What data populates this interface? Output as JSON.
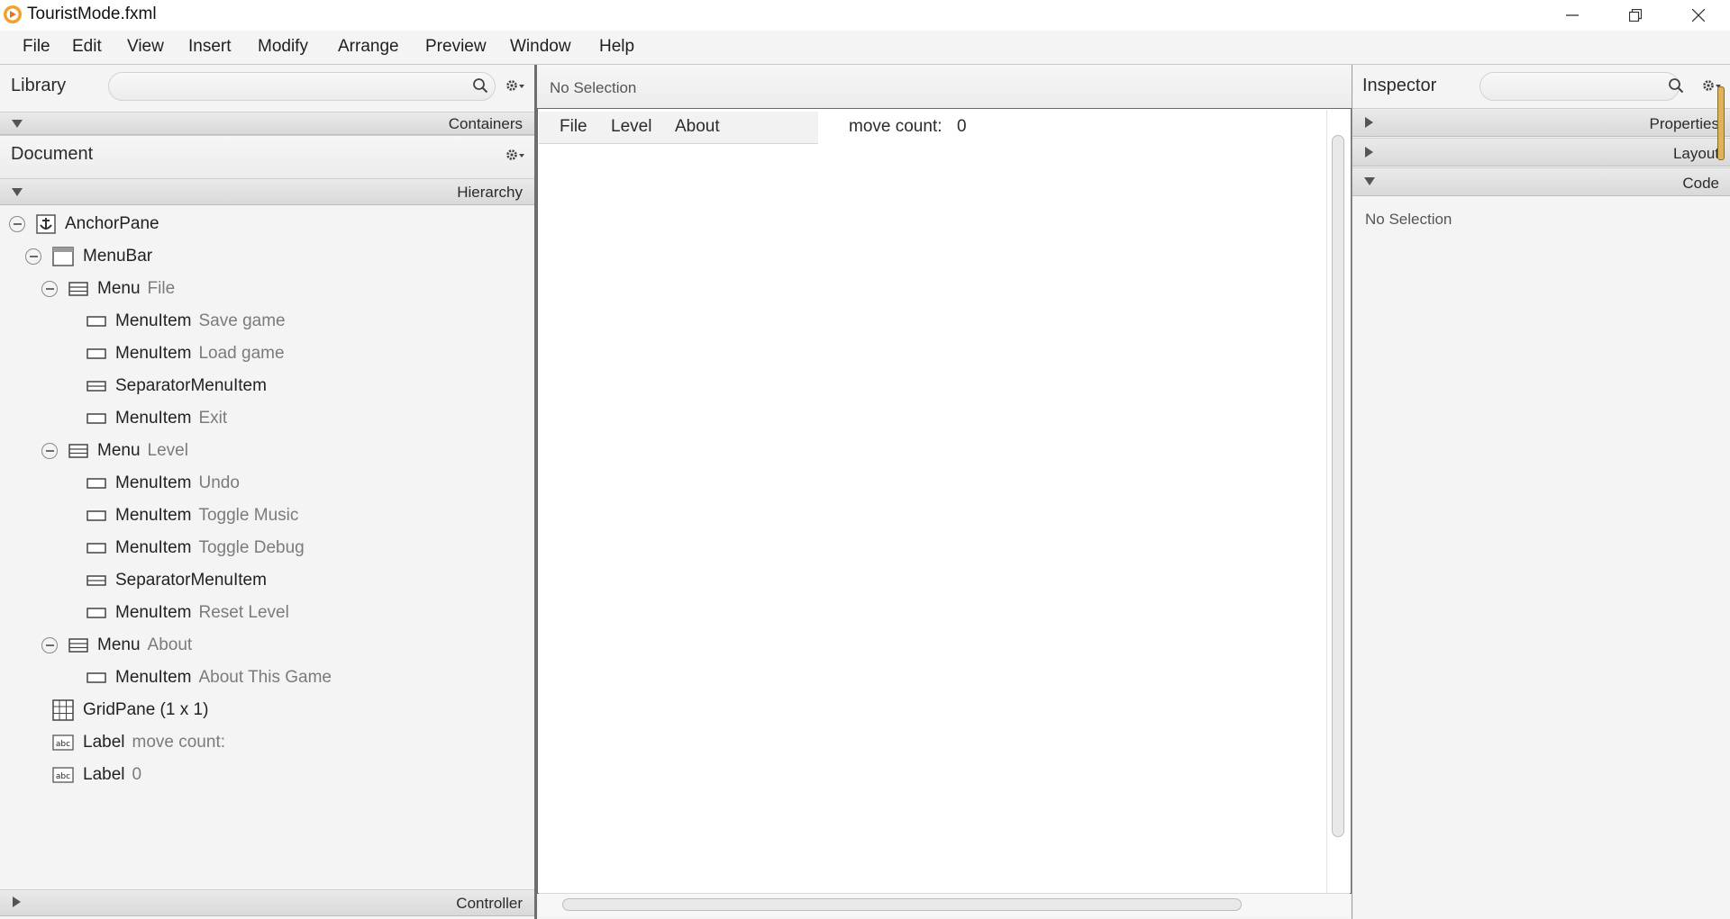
{
  "window": {
    "title": "TouristMode.fxml",
    "minimize_icon": "minimize-icon",
    "restore_icon": "restore-icon",
    "close_icon": "close-icon"
  },
  "menu_bar": [
    "File",
    "Edit",
    "View",
    "Insert",
    "Modify",
    "Arrange",
    "Preview",
    "Window",
    "Help"
  ],
  "library": {
    "title": "Library",
    "search_placeholder": "",
    "sections": [
      {
        "label": "Containers",
        "expanded": false
      }
    ]
  },
  "document": {
    "title": "Document",
    "hierarchy_label": "Hierarchy",
    "controller_label": "Controller",
    "tree": [
      {
        "type": "AnchorPane",
        "text": "",
        "icon": "anchor-icon",
        "depth": 0,
        "toggle": true
      },
      {
        "type": "MenuBar",
        "text": "",
        "icon": "menubar-icon",
        "depth": 1,
        "toggle": true
      },
      {
        "type": "Menu",
        "text": "File",
        "icon": "menu-icon",
        "depth": 2,
        "toggle": true
      },
      {
        "type": "MenuItem",
        "text": "Save game",
        "icon": "menuitem-icon",
        "depth": 3,
        "toggle": false
      },
      {
        "type": "MenuItem",
        "text": "Load game",
        "icon": "menuitem-icon",
        "depth": 3,
        "toggle": false
      },
      {
        "type": "SeparatorMenuItem",
        "text": "",
        "icon": "separator-menuitem-icon",
        "depth": 3,
        "toggle": false
      },
      {
        "type": "MenuItem",
        "text": "Exit",
        "icon": "menuitem-icon",
        "depth": 3,
        "toggle": false
      },
      {
        "type": "Menu",
        "text": "Level",
        "icon": "menu-icon",
        "depth": 2,
        "toggle": true
      },
      {
        "type": "MenuItem",
        "text": "Undo",
        "icon": "menuitem-icon",
        "depth": 3,
        "toggle": false
      },
      {
        "type": "MenuItem",
        "text": "Toggle Music",
        "icon": "menuitem-icon",
        "depth": 3,
        "toggle": false
      },
      {
        "type": "MenuItem",
        "text": "Toggle Debug",
        "icon": "menuitem-icon",
        "depth": 3,
        "toggle": false
      },
      {
        "type": "SeparatorMenuItem",
        "text": "",
        "icon": "separator-menuitem-icon",
        "depth": 3,
        "toggle": false
      },
      {
        "type": "MenuItem",
        "text": "Reset Level",
        "icon": "menuitem-icon",
        "depth": 3,
        "toggle": false
      },
      {
        "type": "Menu",
        "text": "About",
        "icon": "menu-icon",
        "depth": 2,
        "toggle": true
      },
      {
        "type": "MenuItem",
        "text": "About This Game",
        "icon": "menuitem-icon",
        "depth": 3,
        "toggle": false
      },
      {
        "type": "GridPane (1 x 1)",
        "text": "",
        "icon": "gridpane-icon",
        "depth": 1,
        "toggle": false
      },
      {
        "type": "Label",
        "text": "move count:",
        "icon": "label-icon",
        "depth": 1,
        "toggle": false
      },
      {
        "type": "Label",
        "text": "0",
        "icon": "label-icon",
        "depth": 1,
        "toggle": false
      }
    ]
  },
  "content": {
    "selection_status": "No Selection",
    "preview_menus": [
      "File",
      "Level",
      "About"
    ],
    "move_count_label": "move count:",
    "move_count_value": "0"
  },
  "inspector": {
    "title": "Inspector",
    "search_placeholder": "",
    "sections": [
      {
        "label": "Properties",
        "expanded": false
      },
      {
        "label": "Layout",
        "expanded": false
      },
      {
        "label": "Code",
        "expanded": true
      }
    ],
    "empty_text": "No Selection"
  }
}
